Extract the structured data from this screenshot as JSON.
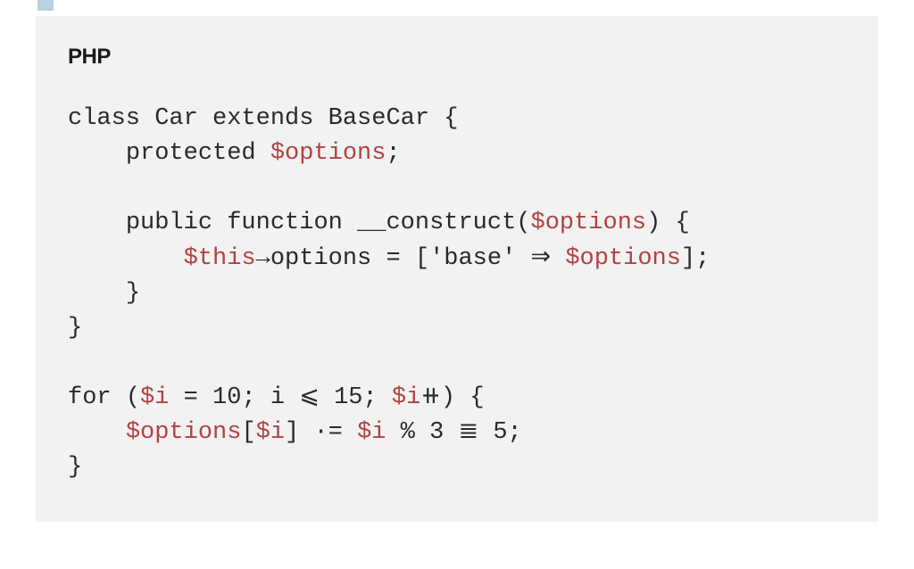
{
  "lang_label": "PHP",
  "code": {
    "l1": {
      "kw1": "class",
      "cls1": "Car",
      "kw2": "extends",
      "cls2": "BaseCar"
    },
    "l2": {
      "kw": "protected",
      "var": "$options"
    },
    "l4": {
      "kw1": "public",
      "kw2": "function",
      "fn": "__construct",
      "var": "$options"
    },
    "l5": {
      "var1": "$this",
      "arrow": "→",
      "prop": "options",
      "str": "'base'",
      "darrow": "⇒",
      "var2": "$options"
    },
    "l9": {
      "kw": "for",
      "var": "$i",
      "n1": "10",
      "v2": "i",
      "leq": "⩽",
      "n2": "15",
      "var3": "$i",
      "pp": "⧺"
    },
    "l10": {
      "var1": "$options",
      "var2": "$i",
      "dot_eq": "·=",
      "var3": "$i",
      "pct": "%",
      "n1": "3",
      "eq4": "≣",
      "n2": "5"
    }
  }
}
